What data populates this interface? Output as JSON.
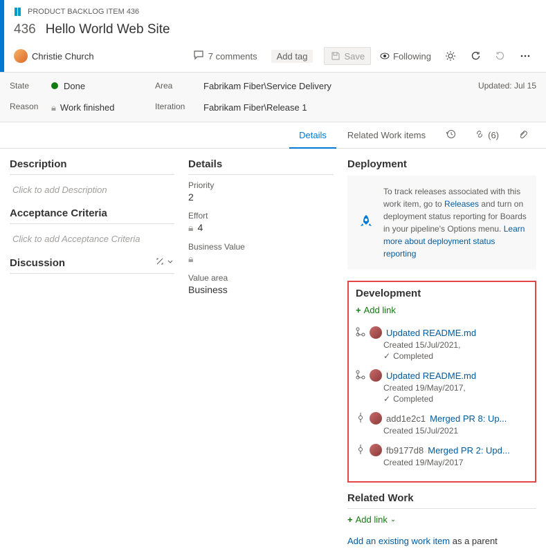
{
  "header": {
    "type_label": "PRODUCT BACKLOG ITEM 436",
    "id": "436",
    "title": "Hello World Web Site",
    "author": "Christie Church",
    "comments_label": "7 comments",
    "add_tag": "Add tag",
    "save": "Save",
    "following": "Following"
  },
  "info": {
    "state_label": "State",
    "state_value": "Done",
    "reason_label": "Reason",
    "reason_value": "Work finished",
    "area_label": "Area",
    "area_value": "Fabrikam Fiber\\Service Delivery",
    "iteration_label": "Iteration",
    "iteration_value": "Fabrikam Fiber\\Release 1",
    "updated": "Updated: Jul 15"
  },
  "tabs": {
    "details": "Details",
    "related": "Related Work items",
    "links_count": "(6)"
  },
  "left": {
    "description_h": "Description",
    "description_ph": "Click to add Description",
    "acceptance_h": "Acceptance Criteria",
    "acceptance_ph": "Click to add Acceptance Criteria",
    "discussion_h": "Discussion"
  },
  "details": {
    "heading": "Details",
    "priority_lbl": "Priority",
    "priority_val": "2",
    "effort_lbl": "Effort",
    "effort_val": "4",
    "bv_lbl": "Business Value",
    "va_lbl": "Value area",
    "va_val": "Business"
  },
  "deploy": {
    "heading": "Deployment",
    "text1": "To track releases associated with this work item, go to ",
    "releases": "Releases",
    "text2": " and turn on deployment status reporting for Boards in your pipeline's Options menu. ",
    "learn": "Learn more about deployment status reporting"
  },
  "dev": {
    "heading": "Development",
    "add_link": "Add link",
    "items": [
      {
        "type": "pr",
        "title": "Updated README.md",
        "sub": "Created 15/Jul/2021,",
        "status": "Completed"
      },
      {
        "type": "pr",
        "title": "Updated README.md",
        "sub": "Created 19/May/2017,",
        "status": "Completed"
      },
      {
        "type": "commit",
        "hash": "add1e2c1",
        "title": "Merged PR 8: Up...",
        "sub": "Created 15/Jul/2021"
      },
      {
        "type": "commit",
        "hash": "fb9177d8",
        "title": "Merged PR 2: Upd...",
        "sub": "Created 19/May/2017"
      }
    ]
  },
  "related": {
    "heading": "Related Work",
    "add_link": "Add link",
    "parent_link": "Add an existing work item",
    "parent_suffix": " as a parent"
  }
}
